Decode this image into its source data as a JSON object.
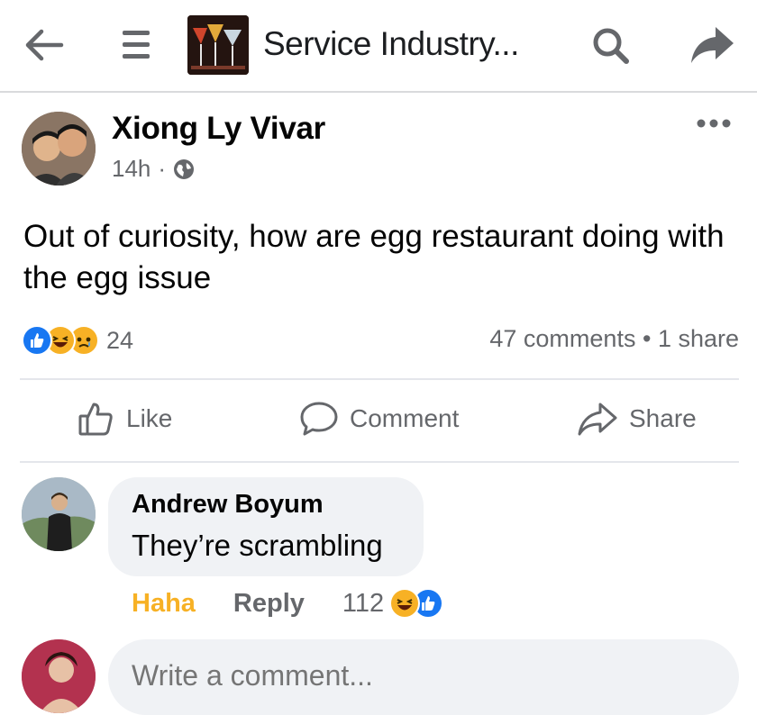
{
  "header": {
    "group_name": "Service Industry...",
    "icons": [
      "back-arrow-icon",
      "menu-icon",
      "search-icon",
      "share-arrow-icon"
    ]
  },
  "post": {
    "author": "Xiong Ly Vivar",
    "time": "14h",
    "audience_icon": "globe-icon",
    "text": "Out of curiosity, how are egg restaurant doing with the egg issue",
    "reaction_count": "24",
    "reaction_icons": [
      "like-icon",
      "haha-icon",
      "sad-icon"
    ],
    "comments_count": "47 comments",
    "shares_count": "1 share",
    "separator": "•"
  },
  "actions": {
    "like_label": "Like",
    "comment_label": "Comment",
    "share_label": "Share"
  },
  "comment": {
    "author": "Andrew Boyum",
    "text": "They’re scrambling",
    "my_reaction": "Haha",
    "reply_label": "Reply",
    "reaction_count": "112",
    "reaction_icons": [
      "haha-icon",
      "like-icon"
    ]
  },
  "composer": {
    "placeholder": "Write a comment..."
  },
  "colors": {
    "like_blue": "#1877f2",
    "haha_yellow": "#f7b125",
    "secondary_text": "#65676b",
    "bubble_bg": "#f0f2f5"
  }
}
